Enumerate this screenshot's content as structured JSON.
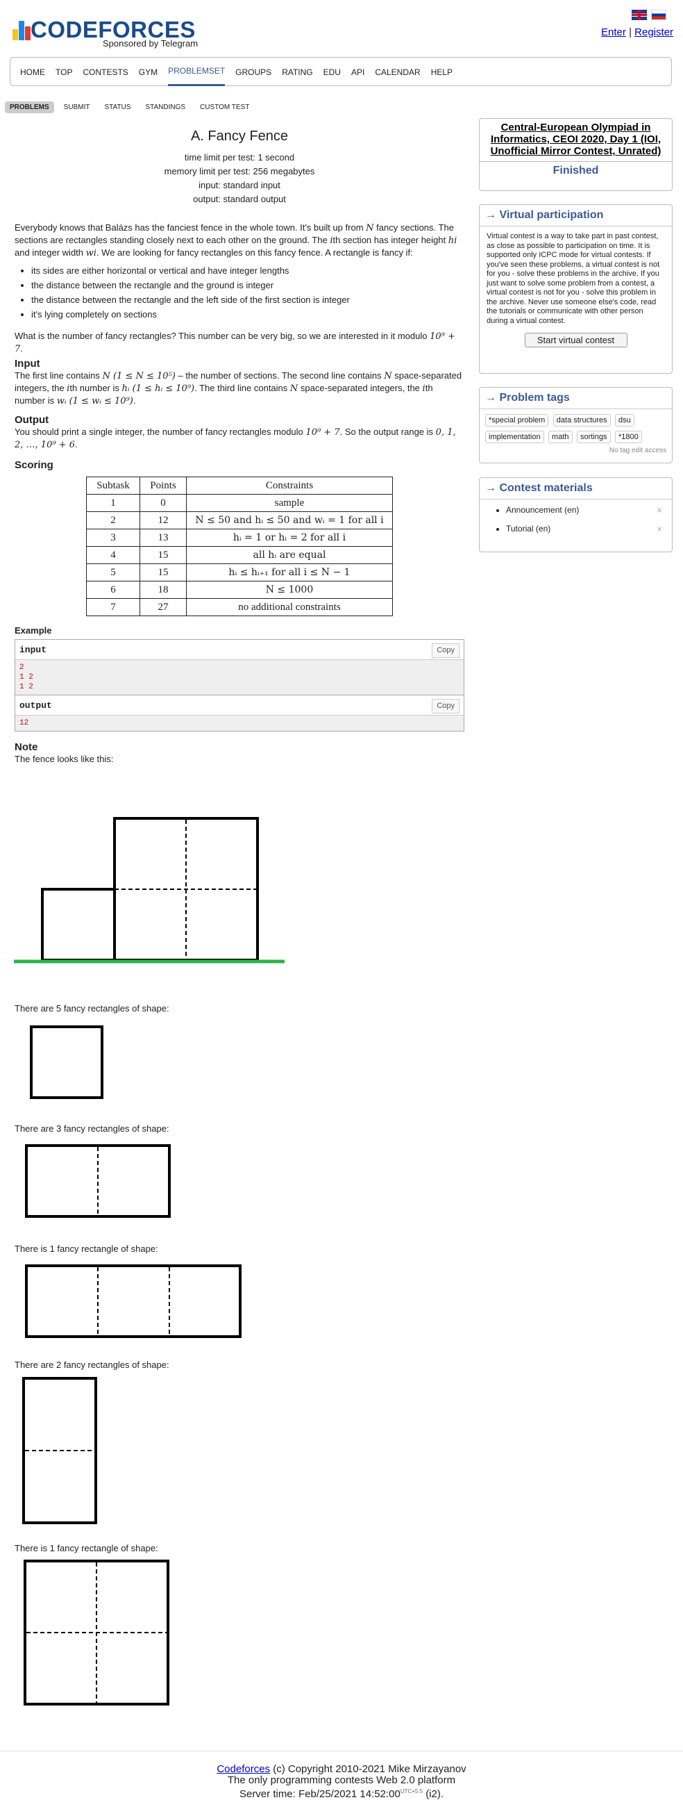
{
  "header": {
    "logo_text": "CODEFORCES",
    "logo_sub": "Sponsored by Telegram",
    "enter": "Enter",
    "separator": "|",
    "register": "Register"
  },
  "menu": [
    "Home",
    "Top",
    "Contests",
    "Gym",
    "Problemset",
    "Groups",
    "Rating",
    "Edu",
    "API",
    "Calendar",
    "Help"
  ],
  "menu_active": "Problemset",
  "subtabs": [
    "Problems",
    "Submit",
    "Status",
    "Standings",
    "Custom test"
  ],
  "problem": {
    "title": "A. Fancy Fence",
    "time_limit": "time limit per test: 1 second",
    "memory_limit": "memory limit per test: 256 megabytes",
    "input": "input: standard input",
    "output": "output: standard output",
    "legend_1": "Everybody knows that Balázs has the fanciest fence in the whole town. It's built up from",
    "legend_N": "N",
    "legend_2": "fancy sections. The sections are rectangles standing closely next to each other on the ground. The",
    "legend_i": "i",
    "legend_3": "th section has integer height",
    "legend_hi": "hi",
    "legend_4": "and integer width",
    "legend_wi": "wi",
    "legend_5": ". We are looking for fancy rectangles on this fancy fence. A rectangle is fancy if:",
    "bullets": [
      "its sides are either horizontal or vertical and have integer lengths",
      "the distance between the rectangle and the ground is integer",
      "the distance between the rectangle and the left side of the first section is integer",
      "it's lying completely on sections"
    ],
    "question": "What is the number of fancy rectangles? This number can be very big, so we are interested in it modulo",
    "modulo": "10⁹ + 7",
    "input_title": "Input",
    "input_text_1": "The first line contains",
    "input_N_bound": "N (1 ≤ N ≤ 10⁵)",
    "input_text_2": "– the number of sections. The second line contains",
    "input_N": "N",
    "input_text_3": "space-separated integers, the",
    "input_i": "i",
    "input_text_4": "th number is",
    "input_h_bound": "hᵢ (1 ≤ hᵢ ≤ 10⁹)",
    "input_text_5": ". The third line contains",
    "input_text_6": "space-separated integers, the",
    "input_w_bound": "wᵢ (1 ≤ wᵢ ≤ 10⁹)",
    "output_title": "Output",
    "output_text_1": "You should print a single integer, the number of fancy rectangles modulo",
    "output_text_2": ". So the output range is",
    "output_range": "0, 1, 2, …, 10⁹ + 6",
    "scoring_title": "Scoring",
    "scoring_headers": [
      "Subtask",
      "Points",
      "Constraints"
    ],
    "scoring_rows": [
      [
        "1",
        "0",
        "sample"
      ],
      [
        "2",
        "12",
        "N ≤ 50 and hᵢ ≤ 50 and wᵢ = 1 for all i"
      ],
      [
        "3",
        "13",
        "hᵢ = 1 or hᵢ = 2 for all i"
      ],
      [
        "4",
        "15",
        "all hᵢ are equal"
      ],
      [
        "5",
        "15",
        "hᵢ ≤ hᵢ₊₁ for all i ≤ N − 1"
      ],
      [
        "6",
        "18",
        "N ≤ 1000"
      ],
      [
        "7",
        "27",
        "no additional constraints"
      ]
    ],
    "example_title": "Example",
    "sample_input_label": "input",
    "sample_output_label": "output",
    "copy": "Copy",
    "sample_input": "2\n1 2\n1 2",
    "sample_output": "12",
    "note_title": "Note",
    "note_intro": "The fence looks like this:",
    "shape_captions": [
      "There are 5 fancy rectangles of shape:",
      "There are 3 fancy rectangles of shape:",
      "There is 1 fancy rectangle of shape:",
      "There are 2 fancy rectangles of shape:",
      "There is 1 fancy rectangle of shape:"
    ]
  },
  "sidebar": {
    "contest_name": "Central-European Olympiad in Informatics, CEOI 2020, Day 1 (IOI, Unofficial Mirror Contest, Unrated)",
    "contest_status": "Finished",
    "virtual_title": "→ Virtual participation",
    "virtual_text": "Virtual contest is a way to take part in past contest, as close as possible to participation on time. It is supported only ICPC mode for virtual contests. If you've seen these problems, a virtual contest is not for you - solve these problems in the archive. If you just want to solve some problem from a contest, a virtual contest is not for you - solve this problem in the archive. Never use someone else's code, read the tutorials or communicate with other person during a virtual contest.",
    "virtual_button": "Start virtual contest",
    "tags_title": "→ Problem tags",
    "tags": [
      "*special problem",
      "data structures",
      "dsu",
      "implementation",
      "math",
      "sortings",
      "*1800"
    ],
    "no_tag_edit": "No tag edit access",
    "materials_title": "→ Contest materials",
    "materials": [
      "Announcement (en)",
      "Tutorial (en)"
    ],
    "remove_mark": "×"
  },
  "footer": {
    "line1_link": "Codeforces",
    "line1_rest": "(c) Copyright 2010-2021 Mike Mirzayanov",
    "line2": "The only programming contests Web 2.0 platform",
    "line3_a": "Server time: Feb/25/2021 14:52:00",
    "line3_sup": "UTC+5.5",
    "line3_b": "(i2)."
  },
  "colors": {
    "accent": "#3b5998",
    "ground": "#2db34a",
    "logo_yellow": "#f5c518",
    "logo_blue": "#1e88e5",
    "logo_red": "#e53935"
  }
}
